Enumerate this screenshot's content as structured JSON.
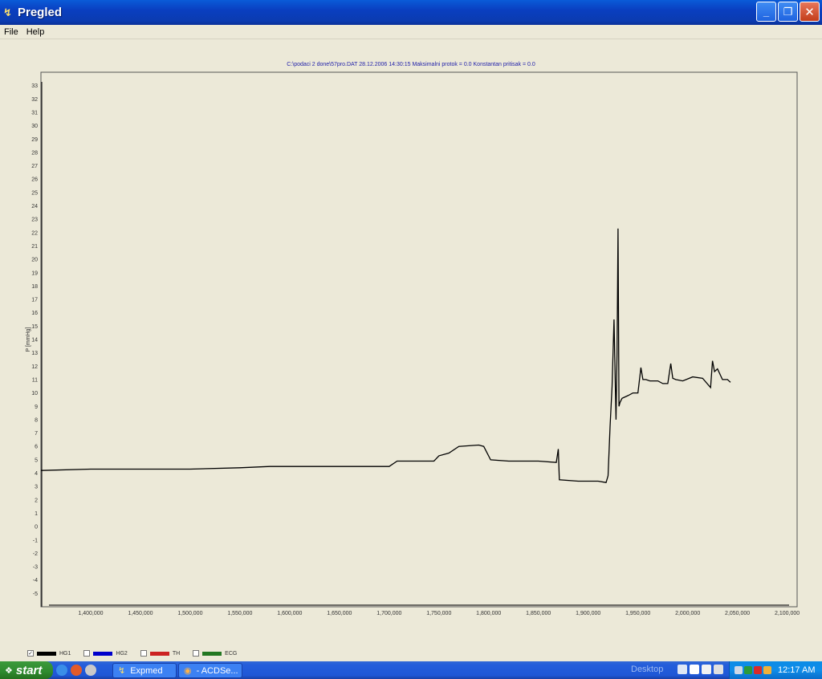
{
  "window": {
    "title": "Pregled"
  },
  "menu": {
    "items": [
      "File",
      "Help"
    ]
  },
  "chart_title": "C:\\podaci 2 done\\57pro.DAT 28.12.2006 14:30:15 Maksimalni protok =  0.0 Konstantan pritisak = 0.0",
  "chart_data": {
    "type": "line",
    "title": "C:\\podaci 2 done\\57pro.DAT 28.12.2006 14:30:15 Maksimalni protok =  0.0 Konstantan pritisak = 0.0",
    "xlabel": "",
    "ylabel": "P [mmHg]",
    "xlim": [
      1350000,
      2110000
    ],
    "ylim": [
      -6,
      34
    ],
    "x_ticks": [
      "1,400,000",
      "1,450,000",
      "1,500,000",
      "1,550,000",
      "1,600,000",
      "1,650,000",
      "1,700,000",
      "1,750,000",
      "1,800,000",
      "1,850,000",
      "1,900,000",
      "1,950,000",
      "2,000,000",
      "2,050,000",
      "2,100,000"
    ],
    "y_ticks": [
      "33",
      "32",
      "31",
      "30",
      "29",
      "28",
      "27",
      "26",
      "25",
      "24",
      "23",
      "22",
      "21",
      "20",
      "19",
      "18",
      "17",
      "16",
      "15",
      "14",
      "13",
      "12",
      "11",
      "10",
      "9",
      "8",
      "7",
      "6",
      "5",
      "4",
      "3",
      "2",
      "1",
      "0",
      "-1",
      "-2",
      "-3",
      "-4",
      "-5"
    ],
    "grid": true,
    "series": [
      {
        "name": "HG1",
        "color": "#000000",
        "x": [
          1350000,
          1400000,
          1450000,
          1500000,
          1550000,
          1580000,
          1600000,
          1650000,
          1700000,
          1708000,
          1730000,
          1745000,
          1750000,
          1760000,
          1770000,
          1790000,
          1795000,
          1802000,
          1820000,
          1850000,
          1868000,
          1870000,
          1871000,
          1890000,
          1910000,
          1918000,
          1920000,
          1922000,
          1924000,
          1926000,
          1928000,
          1929000,
          1930000,
          1931000,
          1932000,
          1934000,
          1940000,
          1945000,
          1950000,
          1953000,
          1955000,
          1958000,
          1962000,
          1970000,
          1975000,
          1980000,
          1983000,
          1985000,
          1988000,
          1995000,
          2005000,
          2015000,
          2023000,
          2025000,
          2027000,
          2030000,
          2035000,
          2040000,
          2043000
        ],
        "y": [
          4.2,
          4.3,
          4.3,
          4.3,
          4.4,
          4.5,
          4.5,
          4.5,
          4.5,
          4.9,
          4.9,
          4.9,
          5.3,
          5.5,
          6.0,
          6.1,
          6.0,
          5.0,
          4.9,
          4.9,
          4.8,
          5.8,
          3.5,
          3.4,
          3.4,
          3.3,
          3.8,
          7.5,
          10.5,
          15.5,
          8.0,
          13.0,
          22.3,
          9.0,
          9.3,
          9.6,
          9.8,
          10.0,
          10.0,
          11.9,
          11.0,
          11.0,
          10.9,
          10.9,
          10.7,
          10.7,
          12.2,
          11.1,
          11.0,
          10.9,
          11.2,
          11.1,
          10.4,
          12.4,
          11.6,
          11.8,
          11.0,
          11.0,
          10.8
        ]
      }
    ],
    "legend": [
      {
        "label": "HG1",
        "color": "#000000",
        "checked": true
      },
      {
        "label": "HG2",
        "color": "#0000cc",
        "checked": false
      },
      {
        "label": "TH",
        "color": "#cc2222",
        "checked": false
      },
      {
        "label": "ECG",
        "color": "#227722",
        "checked": false
      }
    ]
  },
  "taskbar": {
    "start_label": "start",
    "tasks": [
      {
        "label": "Expmed",
        "icon": "app-icon"
      },
      {
        "label": "- ACDSe...",
        "icon": "acdsee-icon"
      }
    ],
    "desktop_label": "Desktop",
    "clock": "12:17 AM"
  }
}
